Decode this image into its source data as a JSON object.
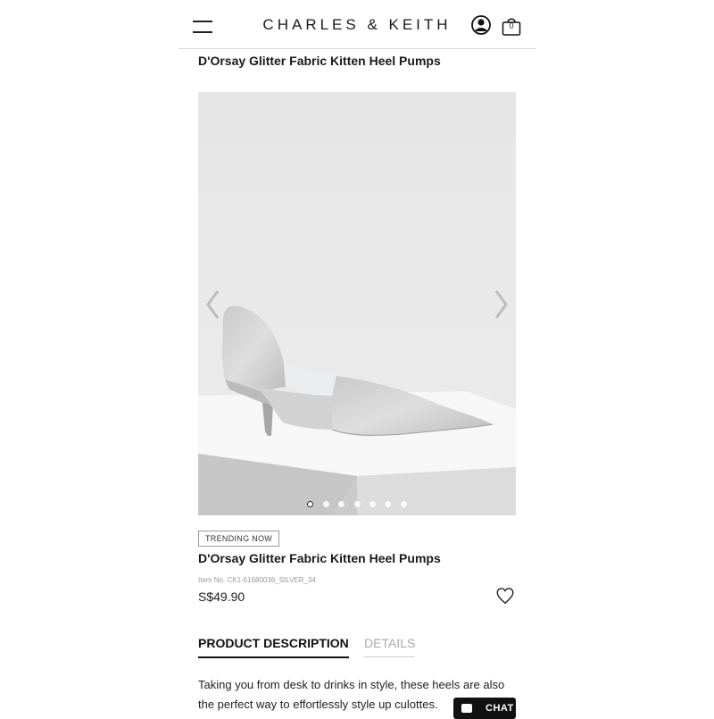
{
  "header": {
    "brand": "CHARLES & KEITH",
    "menu_icon": "hamburger-menu-icon",
    "user_icon": "user-account-icon",
    "bag_icon": "shopping-bag-icon",
    "bag_count": "0"
  },
  "product": {
    "top_title": "D'Orsay Glitter Fabric Kitten Heel Pumps",
    "badge": "TRENDING NOW",
    "title": "D'Orsay Glitter Fabric Kitten Heel Pumps",
    "item_no": "Item No. CK1-61680036_SILVER_34",
    "price": "S$49.90",
    "wishlist_icon": "heart-icon"
  },
  "gallery": {
    "image_count": 7,
    "active_index": 0,
    "prev_icon": "chevron-left-icon",
    "next_icon": "chevron-right-icon"
  },
  "tabs": {
    "description": "PRODUCT DESCRIPTION",
    "details": "DETAILS",
    "active": "description"
  },
  "description_text": "Taking you from desk to drinks in style, these heels are also the perfect way to effortlessly style up culottes.",
  "chat": {
    "label": "CHAT",
    "icon": "chat-bubble-icon"
  },
  "colors": {
    "accent": "#111111",
    "gallery_bg": "#e8e8e8",
    "inactive_tab": "#aaaaaa"
  }
}
